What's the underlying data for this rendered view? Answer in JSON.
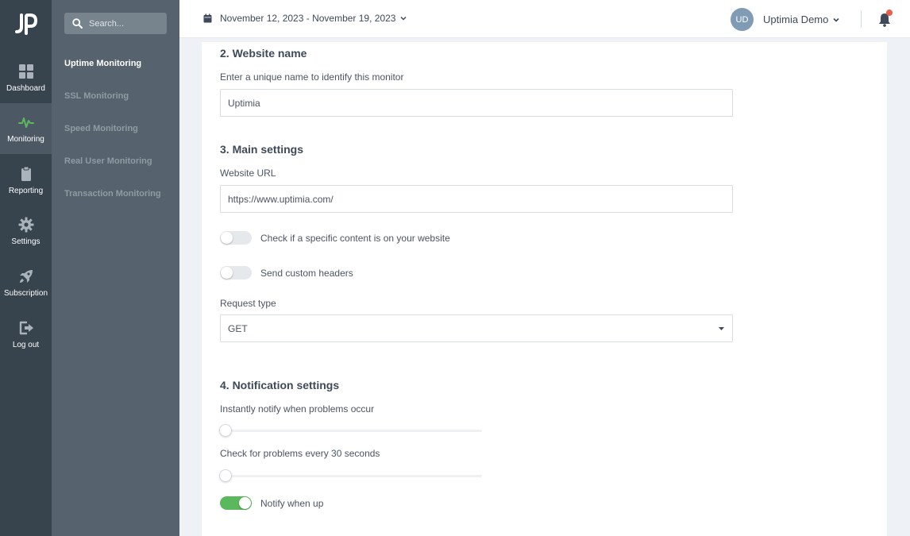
{
  "sidebar": {
    "items": [
      {
        "label": "Dashboard",
        "icon": "grid-icon"
      },
      {
        "label": "Monitoring",
        "icon": "pulse-icon"
      },
      {
        "label": "Reporting",
        "icon": "clipboard-icon"
      },
      {
        "label": "Settings",
        "icon": "gear-icon"
      },
      {
        "label": "Subscription",
        "icon": "rocket-icon"
      },
      {
        "label": "Log out",
        "icon": "logout-icon"
      }
    ],
    "active": "Monitoring"
  },
  "subnav": {
    "search_placeholder": "Search...",
    "items": [
      {
        "label": "Uptime Monitoring"
      },
      {
        "label": "SSL Monitoring"
      },
      {
        "label": "Speed Monitoring"
      },
      {
        "label": "Real User Monitoring"
      },
      {
        "label": "Transaction Monitoring"
      }
    ],
    "active": "Uptime Monitoring"
  },
  "header": {
    "date_range": "November 12, 2023 - November 19, 2023",
    "user_initials": "UD",
    "user_name": "Uptimia Demo"
  },
  "form": {
    "section2_title": "2. Website name",
    "name_label": "Enter a unique name to identify this monitor",
    "name_value": "Uptimia",
    "section3_title": "3. Main settings",
    "url_label": "Website URL",
    "url_value": "https://www.uptimia.com/",
    "content_check_label": "Check if a specific content is on your website",
    "content_check_on": false,
    "custom_headers_label": "Send custom headers",
    "custom_headers_on": false,
    "request_type_label": "Request type",
    "request_type_value": "GET",
    "section4_title": "4. Notification settings",
    "notify_label": "Instantly notify when problems occur",
    "notify_slider_fraction": 0,
    "check_label": "Check for problems every 30 seconds",
    "check_slider_fraction": 0,
    "notify_up_label": "Notify when up",
    "notify_up_on": true
  },
  "colors": {
    "rail_bg": "#37434d",
    "subnav_bg": "#56636e",
    "accent_green": "#5cb85c",
    "notification_dot": "#e8604c",
    "avatar_bg": "#7f9bb5"
  }
}
